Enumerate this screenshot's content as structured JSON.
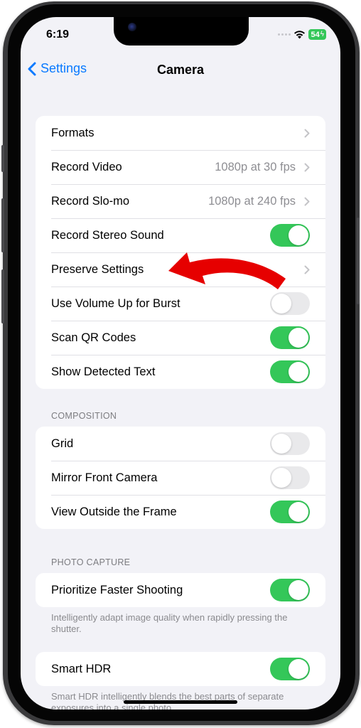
{
  "status_bar": {
    "time": "6:19",
    "battery_level": "54",
    "icons": [
      "signal-dots-icon",
      "wifi-icon",
      "battery-charging-icon"
    ]
  },
  "nav": {
    "back_label": "Settings",
    "title": "Camera"
  },
  "groups": [
    {
      "header": "",
      "rows": [
        {
          "label": "Formats",
          "type": "link",
          "value": ""
        },
        {
          "label": "Record Video",
          "type": "link",
          "value": "1080p at 30 fps"
        },
        {
          "label": "Record Slo-mo",
          "type": "link",
          "value": "1080p at 240 fps"
        },
        {
          "label": "Record Stereo Sound",
          "type": "toggle",
          "on": true
        },
        {
          "label": "Preserve Settings",
          "type": "link",
          "value": ""
        },
        {
          "label": "Use Volume Up for Burst",
          "type": "toggle",
          "on": false
        },
        {
          "label": "Scan QR Codes",
          "type": "toggle",
          "on": true
        },
        {
          "label": "Show Detected Text",
          "type": "toggle",
          "on": true
        }
      ]
    },
    {
      "header": "COMPOSITION",
      "rows": [
        {
          "label": "Grid",
          "type": "toggle",
          "on": false
        },
        {
          "label": "Mirror Front Camera",
          "type": "toggle",
          "on": false
        },
        {
          "label": "View Outside the Frame",
          "type": "toggle",
          "on": true
        }
      ]
    },
    {
      "header": "PHOTO CAPTURE",
      "rows": [
        {
          "label": "Prioritize Faster Shooting",
          "type": "toggle",
          "on": true
        }
      ],
      "footer": "Intelligently adapt image quality when rapidly pressing the shutter."
    },
    {
      "header": "",
      "rows": [
        {
          "label": "Smart HDR",
          "type": "toggle",
          "on": true
        }
      ],
      "footer": "Smart HDR intelligently blends the best parts of separate exposures into a single photo."
    }
  ],
  "annotation": {
    "type": "red-arrow",
    "points_to": "Preserve Settings",
    "color": "#e60000"
  },
  "colors": {
    "accent": "#0a7aff",
    "toggle_on": "#34c759",
    "toggle_off": "#e9e9eb",
    "background": "#f2f2f7"
  }
}
